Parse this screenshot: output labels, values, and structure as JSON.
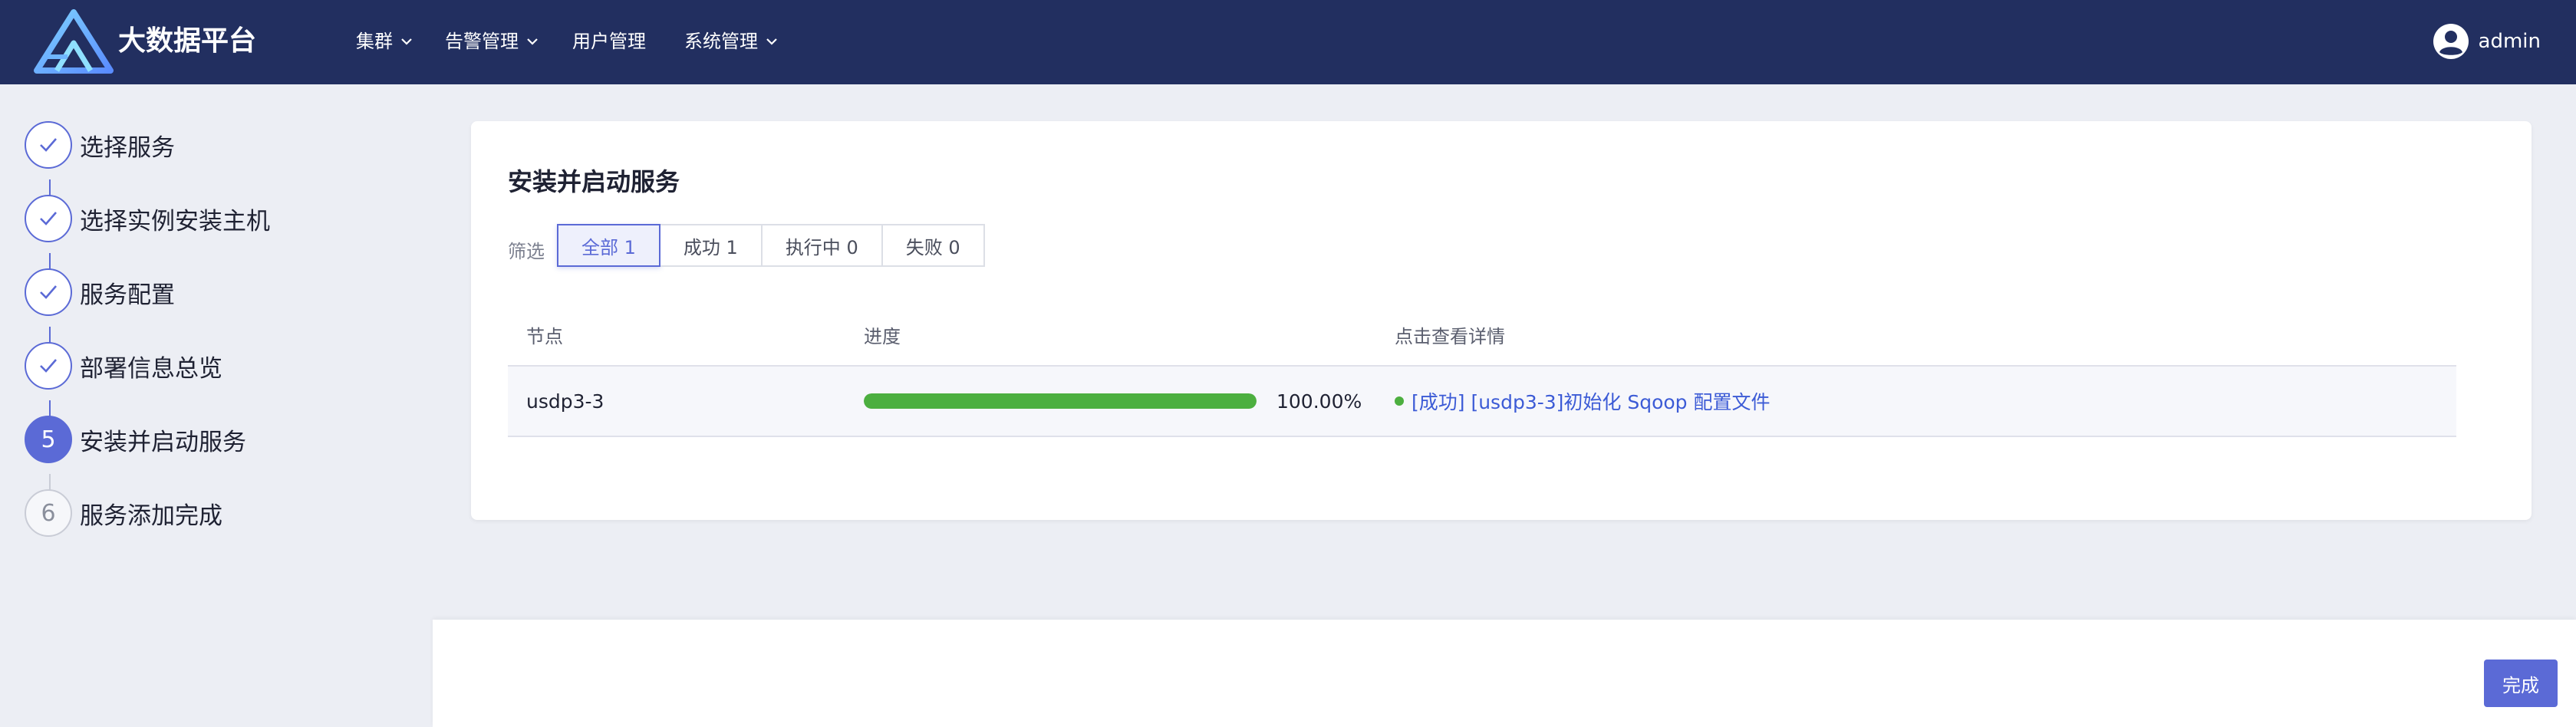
{
  "app": {
    "title": "大数据平台"
  },
  "nav": {
    "items": [
      {
        "label": "集群",
        "has_dropdown": true
      },
      {
        "label": "告警管理",
        "has_dropdown": true
      },
      {
        "label": "用户管理",
        "has_dropdown": false
      },
      {
        "label": "系统管理",
        "has_dropdown": true
      }
    ]
  },
  "user": {
    "name": "admin"
  },
  "steps": [
    {
      "label": "选择服务",
      "status": "done"
    },
    {
      "label": "选择实例安装主机",
      "status": "done"
    },
    {
      "label": "服务配置",
      "status": "done"
    },
    {
      "label": "部署信息总览",
      "status": "done"
    },
    {
      "label": "安装并启动服务",
      "status": "active",
      "number": "5"
    },
    {
      "label": "服务添加完成",
      "status": "pending",
      "number": "6"
    }
  ],
  "card": {
    "title": "安装并启动服务",
    "filter_label": "筛选",
    "filters": [
      {
        "label": "全部 1",
        "active": true
      },
      {
        "label": "成功 1",
        "active": false
      },
      {
        "label": "执行中 0",
        "active": false
      },
      {
        "label": "失败 0",
        "active": false
      }
    ],
    "table": {
      "headers": {
        "node": "节点",
        "progress": "进度",
        "detail": "点击查看详情"
      },
      "rows": [
        {
          "node": "usdp3-3",
          "progress_percent": 100,
          "progress_text": "100.00%",
          "detail": "[成功] [usdp3-3]初始化 Sqoop 配置文件"
        }
      ]
    }
  },
  "footer": {
    "finish_label": "完成"
  },
  "colors": {
    "navbar": "#222f60",
    "accent": "#5b6ad6",
    "success": "#4caf3f",
    "link": "#3c5bd6"
  }
}
